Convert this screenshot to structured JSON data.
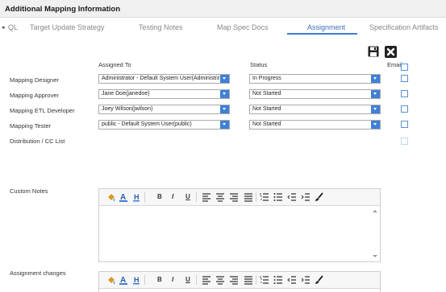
{
  "header": {
    "title": "Additional Mapping Information"
  },
  "tabs": [
    {
      "label": "QL"
    },
    {
      "label": "Target Update Strategy"
    },
    {
      "label": "Testing Notes"
    },
    {
      "label": "Map Spec Docs"
    },
    {
      "label": "Assignment"
    },
    {
      "label": "Specification Artifacts"
    }
  ],
  "columns": {
    "assigned_to": "Assigned To",
    "status": "Status",
    "email": "Email"
  },
  "rows": [
    {
      "label": "Mapping Designer",
      "assigned": "Administrator - Default System User(Administrator)",
      "status": "In Progress"
    },
    {
      "label": "Mapping Approver",
      "assigned": "Jane Doe(janedoe)",
      "status": "Not Started"
    },
    {
      "label": "Mapping ETL Developer",
      "assigned": "Joey Wilson(jwilson)",
      "status": "Not Started"
    },
    {
      "label": "Mapping Tester",
      "assigned": "public - Default System User(public)",
      "status": "Not Started"
    },
    {
      "label": "Distribution / CC List"
    }
  ],
  "custom_notes": {
    "label": "Custom Notes"
  },
  "assignment_changes": {
    "label": "Assignment changes"
  },
  "toolbar": {
    "bold": "B",
    "italic": "I",
    "underline": "U"
  },
  "colors": {
    "accent": "#3b7dd8",
    "arrow": "#3f80d8",
    "checkbox_border": "#5a8fd0"
  }
}
